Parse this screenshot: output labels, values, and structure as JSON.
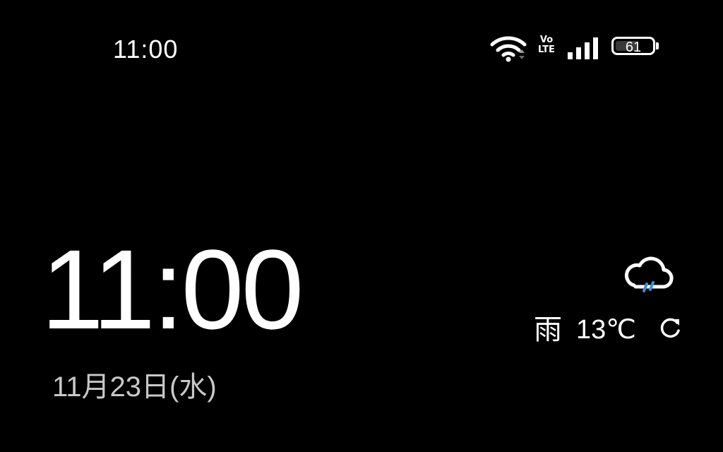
{
  "status_bar": {
    "time": "11:00",
    "volte_top": "Vo",
    "volte_bottom": "LTE",
    "battery_level": "61",
    "battery_fraction": 0.61,
    "icons": [
      "wifi-icon",
      "volte-icon",
      "cellular-signal-icon",
      "battery-icon"
    ]
  },
  "clock": {
    "time": "11:00",
    "date": "11月23日(水)"
  },
  "weather": {
    "condition": "雨",
    "temperature": "13℃",
    "icon": "rain-cloud-icon",
    "rain_color": "#3d8fd8",
    "refresh_icon": "refresh-icon"
  }
}
